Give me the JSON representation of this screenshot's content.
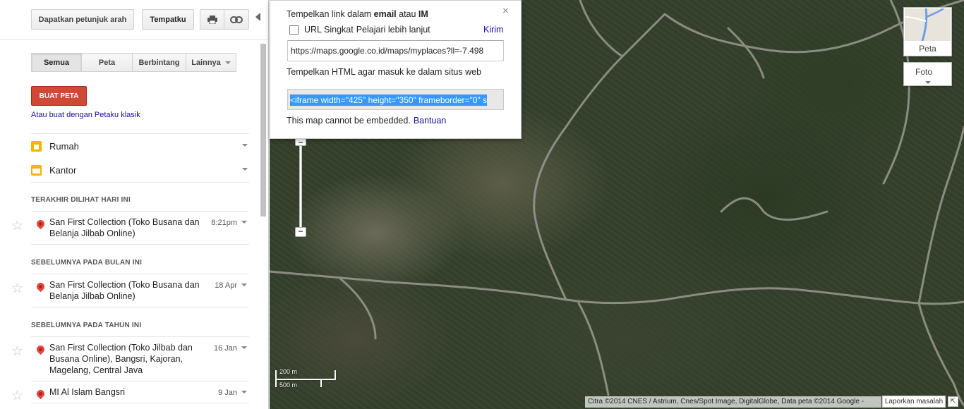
{
  "toolbar": {
    "directions_label": "Dapatkan petunjuk arah",
    "myplaces_label": "Tempatku",
    "print_icon": "printer-icon",
    "link_icon": "link-icon"
  },
  "tabs": [
    {
      "label": "Semua",
      "active": true
    },
    {
      "label": "Peta",
      "active": false
    },
    {
      "label": "Berbintang",
      "active": false
    },
    {
      "label": "Lainnya",
      "active": false
    }
  ],
  "create_map": {
    "button_label": "BUAT PETA",
    "classic_link": "Atau buat dengan Petaku klasik",
    "button_color": "#d14836"
  },
  "places": {
    "home": "Rumah",
    "work": "Kantor"
  },
  "history": {
    "today_heading": "TERAKHIR DILIHAT HARI INI",
    "month_heading": "SEBELUMNYA PADA BULAN INI",
    "year_heading": "SEBELUMNYA PADA TAHUN INI",
    "items": [
      {
        "title": "San First Collection (Toko Busana dan Belanja Jilbab Online)",
        "time": "8:21pm"
      },
      {
        "title": "San First Collection (Toko Busana dan Belanja Jilbab Online)",
        "time": "18 Apr"
      },
      {
        "title": "San First Collection (Toko Jilbab dan Busana Online), Bangsri, Kajoran, Magelang, Central Java",
        "time": "16 Jan"
      },
      {
        "title": "MI Al Islam Bangsri",
        "time": "9 Jan"
      }
    ]
  },
  "share": {
    "paste_prefix": "Tempelkan link dalam ",
    "paste_email": "email",
    "paste_middle": " atau ",
    "paste_im": "IM",
    "short_url_label": "URL Singkat",
    "learn_more": "Pelajari lebih lanjut",
    "send_link": "Kirim",
    "link_value": "https://maps.google.co.id/maps/myplaces?ll=-7.498",
    "embed_label": "Tempelkan HTML agar masuk ke dalam situs web",
    "embed_code": "<iframe width=\"425\" height=\"350\" frameborder=\"0\" s",
    "embed_note": "This map cannot be embedded.",
    "help_link": "Bantuan",
    "close_symbol": "×"
  },
  "map": {
    "maptype_map_label": "Peta",
    "maptype_photo_label": "Foto",
    "scale_top": "200 m",
    "scale_bottom": "500 m",
    "attribution": "Citra ©2014 CNES / Astrium, Cnes/Spot Image, DigitalGlobe, Data peta ©2014 Google -",
    "report_label": "Laporkan masalah",
    "zoom_in_symbol": "−",
    "zoom_out_symbol": "−",
    "corner_symbol": "⇱"
  }
}
